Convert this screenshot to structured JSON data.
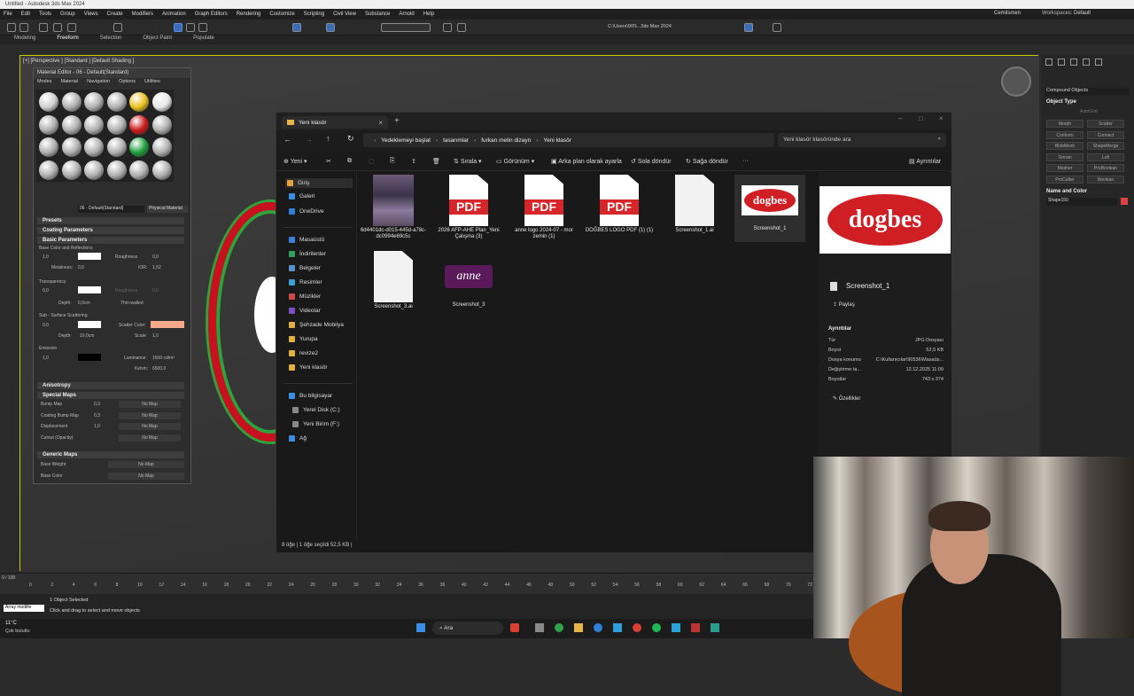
{
  "max": {
    "title": "Untitled - Autodesk 3ds Max 2024",
    "menus": [
      "File",
      "Edit",
      "Tools",
      "Group",
      "Views",
      "Create",
      "Modifiers",
      "Animation",
      "Graph Editors",
      "Rendering",
      "Customize",
      "Scripting",
      "Civil View",
      "Substance",
      "Arnold",
      "Help"
    ],
    "user": "Cemilsmen",
    "workspace_label": "Workspaces:",
    "workspace": "Default",
    "path": "C:\\Users\\90S...3ds Max 2024",
    "ribbon": [
      "Modeling",
      "Freeform",
      "Selection",
      "Object Paint",
      "Populate"
    ],
    "viewport_label": "[+] [Perspective ] [Standard ] [Default Shading ]",
    "status_selected": "1 Object Selected",
    "status_hint": "Click and drag to select and move objects",
    "script_box": "Array modifie",
    "weather_temp": "11°C",
    "weather_desc": "Çok bulutlu",
    "timeline_frame": "0 / 100",
    "ticks": [
      "0",
      "2",
      "4",
      "6",
      "8",
      "10",
      "12",
      "14",
      "16",
      "18",
      "20",
      "22",
      "24",
      "26",
      "28",
      "30",
      "32",
      "34",
      "36",
      "38",
      "40",
      "42",
      "44",
      "46",
      "48",
      "50",
      "52",
      "54",
      "56",
      "58",
      "60",
      "62",
      "64",
      "66",
      "68",
      "70",
      "72"
    ]
  },
  "command_panel": {
    "dropdown": "Compound Objects",
    "section_object_type": "Object Type",
    "autogrid": "AutoGrid",
    "buttons": [
      "Morph",
      "Scatter",
      "Conform",
      "Connect",
      "BlobMesh",
      "ShapeMerge",
      "Terrain",
      "Loft",
      "Mesher",
      "ProBoolean",
      "ProCutter",
      "Boolean"
    ],
    "section_name_color": "Name and Color",
    "object_name": "Shape150",
    "object_color": "#e04040"
  },
  "material_editor": {
    "title": "Material Editor - 06 - Default(Standard)",
    "menus": [
      "Modes",
      "Material",
      "Navigation",
      "Options",
      "Utilities"
    ],
    "material_name": "06 - Default(Standard)",
    "material_type": "Physical Material",
    "sections": {
      "presets": "Presets",
      "coating": "Coating Parameters",
      "basic": "Basic Parameters",
      "anisotropy": "Anisotropy",
      "special": "Special Maps",
      "generic": "Generic Maps"
    },
    "labels": {
      "base_color": "Base Color and Reflections",
      "roughness": "Roughness",
      "metalness": "Metalness:",
      "ior": "IOR:",
      "transparency": "Transparency",
      "depth": "Depth:",
      "thin_walled": "Thin-walled",
      "sss": "Sub - Surface Scattering",
      "scatter_color": "Scatter Color:",
      "scale": "Scale:",
      "emission": "Emission",
      "luminance": "Luminance:",
      "kelvin": "Kelvin:"
    },
    "values": {
      "base": "1,0",
      "roughness": "0,0",
      "metalness": "0,0",
      "ior": "1,52",
      "transparency": "0,0",
      "transparency_rough": "0,0",
      "depth": "0,0cm",
      "sss": "0,0",
      "sss_depth": "10,0cm",
      "sss_scale": "1,0",
      "emission": "1,0",
      "luminance": "1500 cd/m²",
      "kelvin": "6500,0"
    },
    "special_maps": [
      {
        "label": "Bump Map",
        "value": "0,3",
        "map": "No Map"
      },
      {
        "label": "Coating Bump Map",
        "value": "0,3",
        "map": "No Map"
      },
      {
        "label": "Displacement",
        "value": "1,0",
        "map": "No Map"
      },
      {
        "label": "Cutout (Opacity)",
        "value": "",
        "map": "No Map"
      }
    ],
    "generic_maps": [
      {
        "label": "Base Weight",
        "map": "No Map"
      },
      {
        "label": "Base Color",
        "map": "No Map"
      }
    ],
    "sphere_colors": [
      "#d0d0d0",
      "#b0b0b0",
      "#b0b0b0",
      "#b0b0b0",
      "#e8c020",
      "#e8e8e8",
      "#b0b0b0",
      "#b0b0b0",
      "#b0b0b0",
      "#b0b0b0",
      "#cc1a1a",
      "#b0b0b0",
      "#b0b0b0",
      "#b0b0b0",
      "#b0b0b0",
      "#b0b0b0",
      "#22a040",
      "#b0b0b0",
      "#b0b0b0",
      "#b0b0b0",
      "#b0b0b0",
      "#b0b0b0",
      "#b0b0b0",
      "#b0b0b0"
    ]
  },
  "explorer": {
    "tab_title": "Yeni klasör",
    "breadcrumb": [
      "Yedeklemeyi başlat",
      "tasarımlar",
      "furkan melin dizayn",
      "Yeni klasör"
    ],
    "search_placeholder": "Yeni klasör klasöründe ara",
    "commands": {
      "new": "Yeni",
      "sort": "Sırala",
      "view": "Görünüm",
      "set_bg": "Arka plan olarak ayarla",
      "rotate_left": "Sola döndür",
      "rotate_right": "Sağa döndür",
      "more": "···",
      "details": "Ayrıntılar"
    },
    "nav": [
      {
        "label": "Giriş",
        "color": "#e6a040",
        "icon": "home-icon"
      },
      {
        "label": "Galeri",
        "color": "#3c8ee0",
        "icon": "gallery-icon"
      },
      {
        "label": "OneDrive",
        "color": "#2f7fd8",
        "icon": "cloud-icon"
      },
      {
        "label": "Masaüstü",
        "color": "#3c7ee0",
        "icon": "desktop-icon"
      },
      {
        "label": "İndirilenler",
        "color": "#2fa060",
        "icon": "download-icon"
      },
      {
        "label": "Belgeler",
        "color": "#5a8fd0",
        "icon": "documents-icon"
      },
      {
        "label": "Resimler",
        "color": "#3aa0d8",
        "icon": "pictures-icon"
      },
      {
        "label": "Müzikler",
        "color": "#d04848",
        "icon": "music-icon"
      },
      {
        "label": "Videolar",
        "color": "#7a4fc8",
        "icon": "videos-icon"
      },
      {
        "label": "Şehzade Mobilya",
        "color": "#e0b040",
        "icon": "folder-icon"
      },
      {
        "label": "Yurupa",
        "color": "#e0b040",
        "icon": "folder-icon"
      },
      {
        "label": "revize2",
        "color": "#e0b040",
        "icon": "folder-icon"
      },
      {
        "label": "Yeni klasör",
        "color": "#e0b040",
        "icon": "folder-icon"
      },
      {
        "label": "Bu bilgisayar",
        "color": "#3c8ee0",
        "icon": "computer-icon"
      },
      {
        "label": "Yerel Disk (C:)",
        "color": "#888888",
        "icon": "drive-icon"
      },
      {
        "label": "Yeni Birim (F:)",
        "color": "#888888",
        "icon": "drive-icon"
      },
      {
        "label": "Ağ",
        "color": "#3c8ee0",
        "icon": "network-icon"
      }
    ],
    "files": [
      {
        "name": "6d4401dc-d015-445d-a78c-dc0994e69c5c",
        "kind": "photo"
      },
      {
        "name": "2026 AFP-AHE Plan_Yeni Çalışma (3)",
        "kind": "pdf"
      },
      {
        "name": "anne logo 2024-07 - mor zemin (1)",
        "kind": "pdf"
      },
      {
        "name": "DOĞBES LOGO PDF (1) (1)",
        "kind": "pdf"
      },
      {
        "name": "Screenshot_1.ai",
        "kind": "blank"
      },
      {
        "name": "Screenshot_1",
        "kind": "logo"
      },
      {
        "name": "Screenshot_3.ai",
        "kind": "blank"
      },
      {
        "name": "Screenshot_3",
        "kind": "anne"
      }
    ],
    "pdf_label": "PDF",
    "logo_text": "dogbes",
    "anne_text": "anne",
    "preview": {
      "filename": "Screenshot_1",
      "share": "Paylaş",
      "details_title": "Ayrıntılar",
      "details": [
        {
          "k": "Tür",
          "v": "JPG Dosyası"
        },
        {
          "k": "Boyut",
          "v": "52,5 KB"
        },
        {
          "k": "Dosya konumu",
          "v": "C:\\Kullanıcılar\\90536\\Masaüs..."
        },
        {
          "k": "Değiştirme ta...",
          "v": "12.12.2025 11:09"
        },
        {
          "k": "Boyutlar",
          "v": "743 x 374"
        }
      ],
      "properties": "Özellikler"
    },
    "status": "8 öğe  |  1 öğe seçildi  52,5 KB  |"
  },
  "taskbar": {
    "search": "Ara"
  }
}
